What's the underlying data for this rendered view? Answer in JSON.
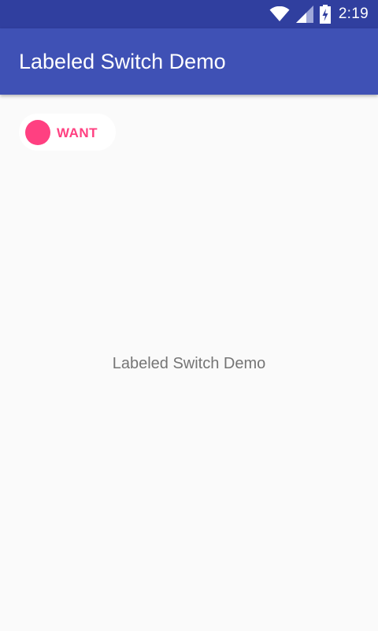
{
  "status_bar": {
    "time": "2:19",
    "icons": [
      "wifi-icon",
      "cell-signal-icon",
      "battery-charging-icon"
    ],
    "background": "#303f9f"
  },
  "app_bar": {
    "title": "Labeled Switch Demo",
    "background": "#3f51b5"
  },
  "labeled_switch": {
    "label": "WANT",
    "checked": true,
    "accent_color": "#ff4081"
  },
  "main": {
    "center_text": "Labeled Switch Demo"
  }
}
